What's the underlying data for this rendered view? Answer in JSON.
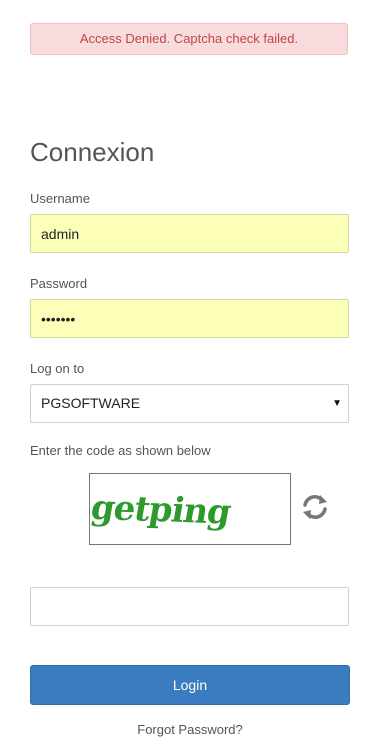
{
  "alert": {
    "message": "Access Denied. Captcha check failed."
  },
  "form": {
    "title": "Connexion",
    "username": {
      "label": "Username",
      "value": "admin"
    },
    "password": {
      "label": "Password",
      "value": "•••••••"
    },
    "domain": {
      "label": "Log on to",
      "value": "PGSOFTWARE"
    },
    "captcha": {
      "label": "Enter the code as shown below",
      "image_text": "getping",
      "input_value": ""
    },
    "login_label": "Login",
    "forgot_label": "Forgot Password?"
  },
  "colors": {
    "alert_bg": "#f8dcdd",
    "alert_text": "#c0454b",
    "autofill_bg": "#fbffb8",
    "primary": "#3b7bbf",
    "captcha_text": "#2e9a2e"
  },
  "icons": {
    "refresh": "refresh-icon",
    "dropdown": "chevron-down-icon"
  }
}
